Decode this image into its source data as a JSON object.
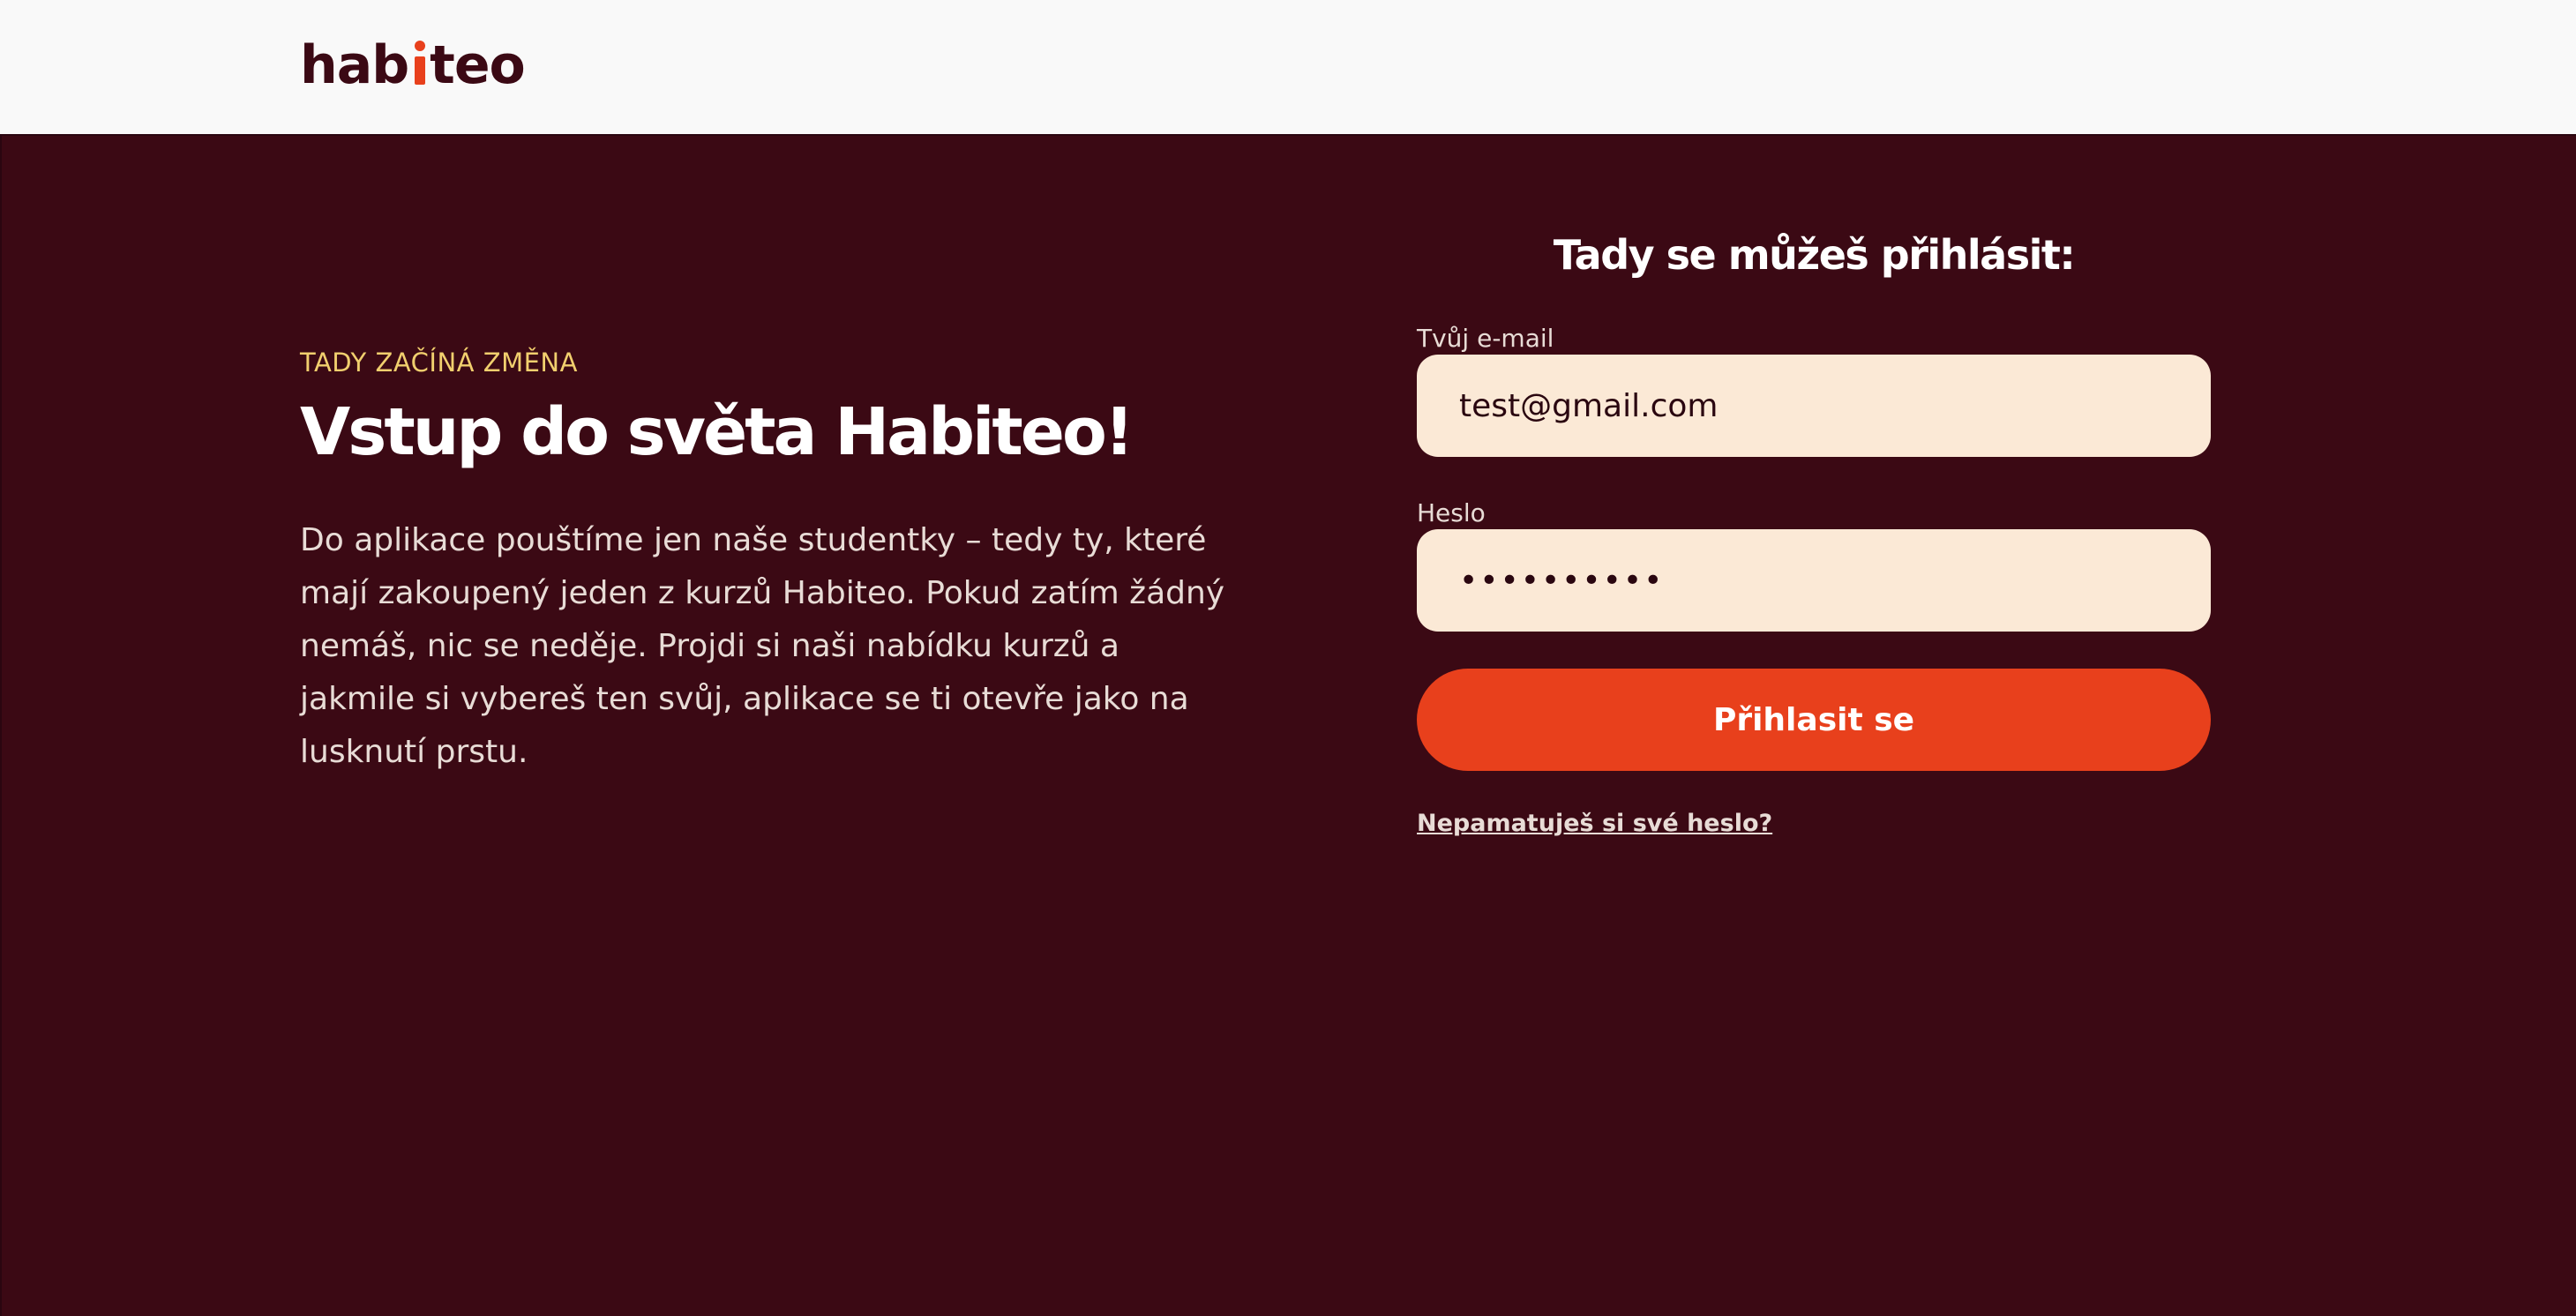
{
  "header": {
    "logo_text_before": "hab",
    "logo_text_after": "teo",
    "logo_accent_color": "#e8401c"
  },
  "intro": {
    "eyebrow": "TADY ZAČÍNÁ ZMĚNA",
    "headline": "Vstup do světa Habiteo!",
    "body": "Do aplikace pouštíme jen naše studentky – tedy ty, které mají zakoupený jeden z kurzů Habiteo. Pokud zatím žádný nemáš, nic se neděje. Projdi si naši nabídku kurzů a jakmile si vybereš ten svůj, aplikace se ti otevře jako na lusknutí prstu."
  },
  "login": {
    "title": "Tady se můžeš přihlásit:",
    "email_label": "Tvůj e-mail",
    "email_value": "test@gmail.com",
    "password_label": "Heslo",
    "password_value": "••••••••••",
    "submit_label": "Přihlasit se",
    "forgot_link": "Nepamatuješ si své heslo?"
  },
  "colors": {
    "background": "#3b0914",
    "header_bg": "#f9f9f9",
    "accent": "#e8401c",
    "eyebrow": "#f1cf6e",
    "input_bg": "#fbe9d6"
  }
}
